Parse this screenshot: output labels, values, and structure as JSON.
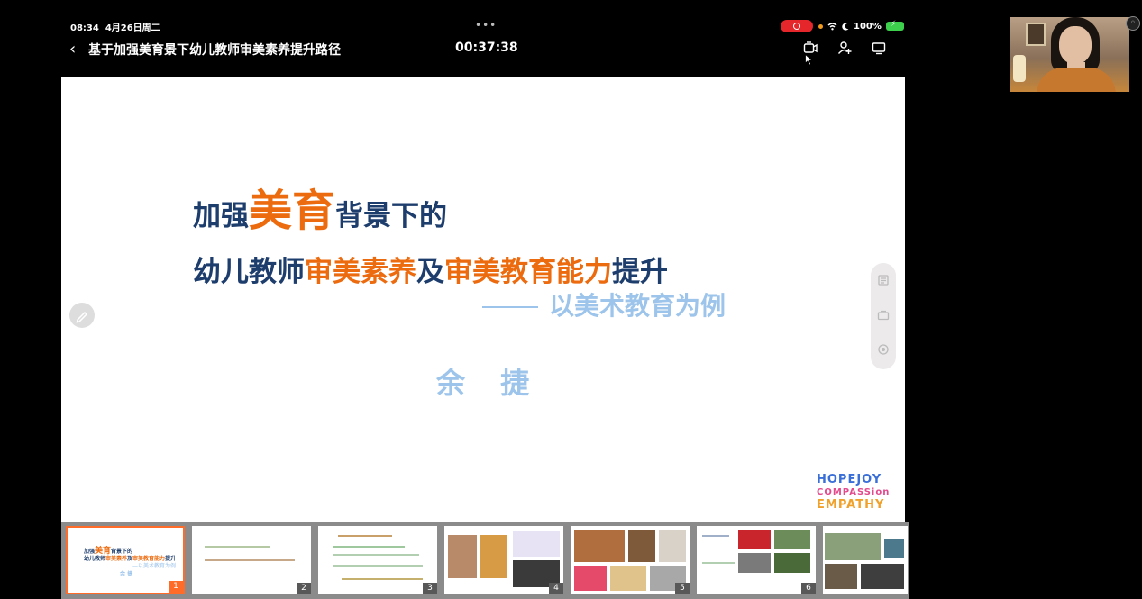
{
  "status_bar": {
    "time": "08:34",
    "date": "4月26日周二",
    "battery": "100%"
  },
  "header": {
    "back_icon": "chevron-left-icon",
    "meeting_title": "基于加强美育景下幼儿教师审美素养提升路径",
    "timer": "00:37:38",
    "icons": [
      "camera-switch-icon",
      "add-member-icon",
      "share-screen-icon"
    ]
  },
  "slide": {
    "line1": {
      "part1": "加强",
      "part2": "美育",
      "part3": "背景下的"
    },
    "line2": {
      "part1": "幼儿教师",
      "part2": "审美素养",
      "part3": "及",
      "part4": "审美教育能力",
      "part5": "提升"
    },
    "subtitle": "以美术教育为例",
    "author": "余 捷",
    "logo_lines": [
      "HOPEJOY",
      "COMPASSion",
      "EMPATHY"
    ]
  },
  "thumbnails": [
    {
      "number": "1",
      "selected": true
    },
    {
      "number": "2"
    },
    {
      "number": "3"
    },
    {
      "number": "4"
    },
    {
      "number": "5"
    },
    {
      "number": "6"
    },
    {
      "number": ""
    }
  ],
  "colors": {
    "accent_orange": "#ec6b0f",
    "title_navy": "#1d3d6d",
    "subtitle_blue": "#9dc4ea",
    "record_red": "#e5262b"
  }
}
